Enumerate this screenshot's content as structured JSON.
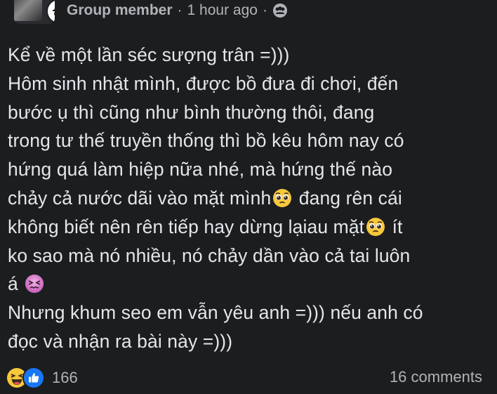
{
  "post": {
    "author": "Group member",
    "separator": "·",
    "time": "1 hour ago",
    "separator2": "·",
    "privacy_icon": "group-icon",
    "body_lines": [
      "Kể về một lần séc sượng trân =)))",
      "Hôm sinh nhật mình, được bồ đưa đi chơi, đến",
      "bước ụ thì cũng như bình thường thôi, đang",
      "trong tư thế truyền thống thì bồ kêu hôm nay có",
      "hứng quá làm hiệp nữa nhé, mà hứng thế nào",
      "chảy cả nước dãi vào mặt mình",
      " đang rên cái",
      "không biết nên rên tiếp hay dừng lạiau mặt",
      " ít",
      "ko sao mà nó nhiều, nó chảy dần vào cả tai luôn",
      "á",
      "Nhưng khum seo em vẫn yêu anh =))) nếu anh có",
      "đọc và nhận ra bài này =)))"
    ],
    "emojis": {
      "pleading_1": "pleading-face-icon",
      "pleading_2": "pleading-face-icon",
      "confounded": "confounded-face-icon"
    }
  },
  "footer": {
    "reaction_icons": [
      "haha-reaction-icon",
      "like-reaction-icon"
    ],
    "reaction_count": "166",
    "comment_count": "16 comments"
  },
  "colors": {
    "background": "#1c1d1f",
    "text": "#e4e6eb",
    "secondary_text": "#b0b3b8",
    "like_blue": "#1877f2",
    "emoji_yellow": "#f7c83b"
  }
}
